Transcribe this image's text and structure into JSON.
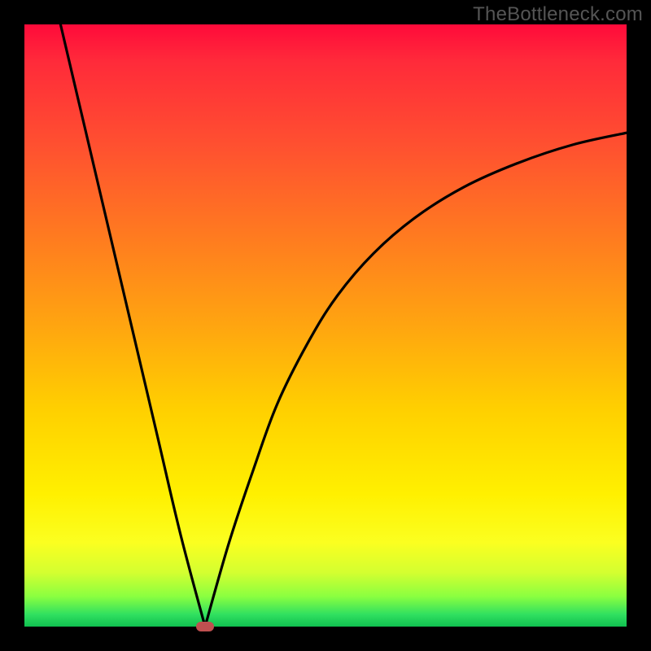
{
  "watermark": "TheBottleneck.com",
  "chart_data": {
    "type": "line",
    "title": "",
    "xlabel": "",
    "ylabel": "",
    "xlim": [
      0,
      100
    ],
    "ylim": [
      0,
      100
    ],
    "grid": false,
    "legend": false,
    "background_gradient": {
      "direction": "vertical",
      "stops": [
        {
          "pos": 0,
          "color": "#ff0a3a"
        },
        {
          "pos": 35,
          "color": "#ff7a20"
        },
        {
          "pos": 64,
          "color": "#ffd000"
        },
        {
          "pos": 86,
          "color": "#fbff20"
        },
        {
          "pos": 100,
          "color": "#10c050"
        }
      ]
    },
    "series": [
      {
        "name": "left-branch",
        "x": [
          6,
          10,
          14,
          18,
          22,
          26,
          30
        ],
        "y": [
          100,
          83,
          66,
          49,
          32,
          15,
          0
        ]
      },
      {
        "name": "right-branch",
        "x": [
          30,
          34,
          38,
          42,
          47,
          52,
          58,
          65,
          73,
          82,
          91,
          100
        ],
        "y": [
          0,
          14,
          26,
          37,
          47,
          55,
          62,
          68,
          73,
          77,
          80,
          82
        ]
      }
    ],
    "minimum_point": {
      "x": 30,
      "y": 0
    },
    "annotations": []
  }
}
